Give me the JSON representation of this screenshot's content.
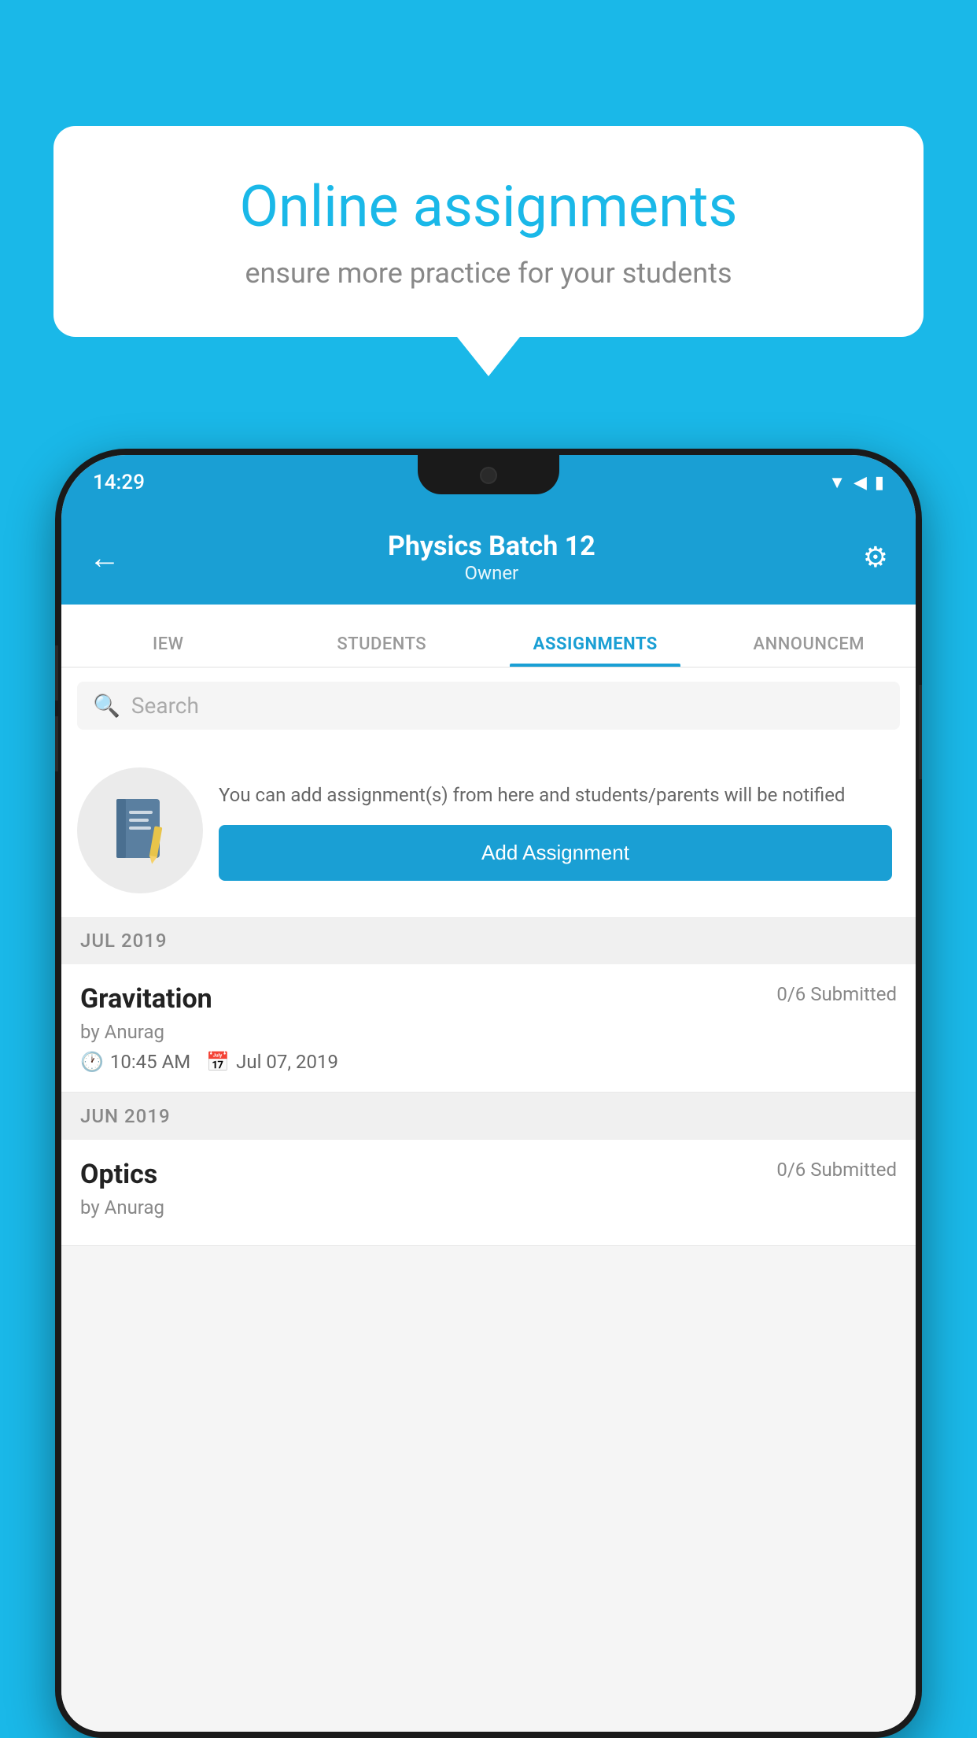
{
  "background_color": "#1ab8e8",
  "speech_bubble": {
    "title": "Online assignments",
    "subtitle": "ensure more practice for your students"
  },
  "status_bar": {
    "time": "14:29",
    "wifi_icon": "wifi",
    "signal_icon": "signal",
    "battery_icon": "battery"
  },
  "header": {
    "title": "Physics Batch 12",
    "subtitle": "Owner",
    "back_label": "←",
    "settings_label": "⚙"
  },
  "tabs": [
    {
      "label": "IEW",
      "active": false
    },
    {
      "label": "STUDENTS",
      "active": false
    },
    {
      "label": "ASSIGNMENTS",
      "active": true
    },
    {
      "label": "ANNOUNCEM",
      "active": false
    }
  ],
  "search": {
    "placeholder": "Search"
  },
  "empty_state": {
    "description": "You can add assignment(s) from here and students/parents will be notified",
    "button_label": "Add Assignment"
  },
  "sections": [
    {
      "label": "JUL 2019",
      "assignments": [
        {
          "name": "Gravitation",
          "submitted": "0/6 Submitted",
          "by": "by Anurag",
          "time": "10:45 AM",
          "date": "Jul 07, 2019"
        }
      ]
    },
    {
      "label": "JUN 2019",
      "assignments": [
        {
          "name": "Optics",
          "submitted": "0/6 Submitted",
          "by": "by Anurag",
          "time": "",
          "date": ""
        }
      ]
    }
  ]
}
